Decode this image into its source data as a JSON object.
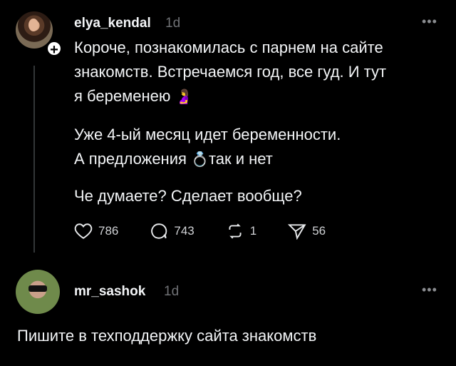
{
  "post": {
    "username": "elya_kendal",
    "time": "1d",
    "more": "•••",
    "lines": [
      "Короче, познакомилась с парнем на сайте",
      "знакомств. Встречаемся год, все гуд. И тут",
      "я беременею",
      "Уже 4-ый месяц идет беременности.",
      "А предложения",
      "так и нет",
      "Че думаете? Сделает вообще?"
    ],
    "emoji_pregnant": "🤰",
    "emoji_ring": "💍",
    "likes": "786",
    "comments": "743",
    "reposts": "1",
    "shares": "56",
    "plus": "+"
  },
  "reply": {
    "username": "mr_sashok",
    "time": "1d",
    "more": "•••",
    "text": "Пишите в техподдержку сайта знакомств"
  },
  "icons": [
    "heart-icon",
    "comment-icon",
    "repost-icon",
    "share-icon",
    "more-icon",
    "plus-icon"
  ]
}
